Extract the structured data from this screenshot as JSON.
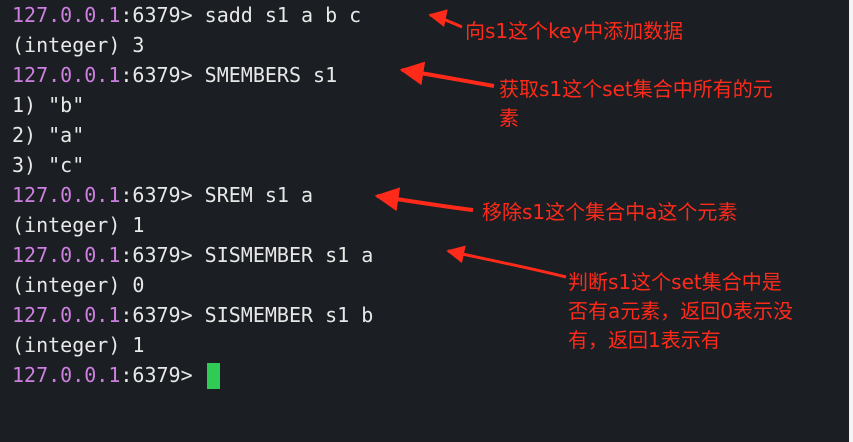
{
  "terminal": {
    "prompt_host": "127.0.0.1",
    "prompt_port": ":6379>",
    "lines": [
      {
        "type": "cmd",
        "text": " sadd s1 a b c"
      },
      {
        "type": "out",
        "text": "(integer) 3"
      },
      {
        "type": "cmd",
        "text": " SMEMBERS s1"
      },
      {
        "type": "out",
        "text": "1) \"b\""
      },
      {
        "type": "out",
        "text": "2) \"a\""
      },
      {
        "type": "out",
        "text": "3) \"c\""
      },
      {
        "type": "cmd",
        "text": " SREM s1 a"
      },
      {
        "type": "out",
        "text": "(integer) 1"
      },
      {
        "type": "cmd",
        "text": " SISMEMBER s1 a"
      },
      {
        "type": "out",
        "text": "(integer) 0"
      },
      {
        "type": "cmd",
        "text": " SISMEMBER s1 b"
      },
      {
        "type": "out",
        "text": "(integer) 1"
      },
      {
        "type": "cmd",
        "text": " "
      }
    ],
    "cursor_color": "#2ecc55",
    "background": "#1b1f23",
    "prompt_host_color": "#cd7fe0"
  },
  "annotations": {
    "color": "#ff2a1a",
    "a1": "向s1这个key中添加数据",
    "a2": "获取s1这个set集合中所有的元\n素",
    "a3": "移除s1这个集合中a这个元素",
    "a4": "判断s1这个set集合中是\n否有a元素，返回0表示没\n有，返回1表示有"
  }
}
